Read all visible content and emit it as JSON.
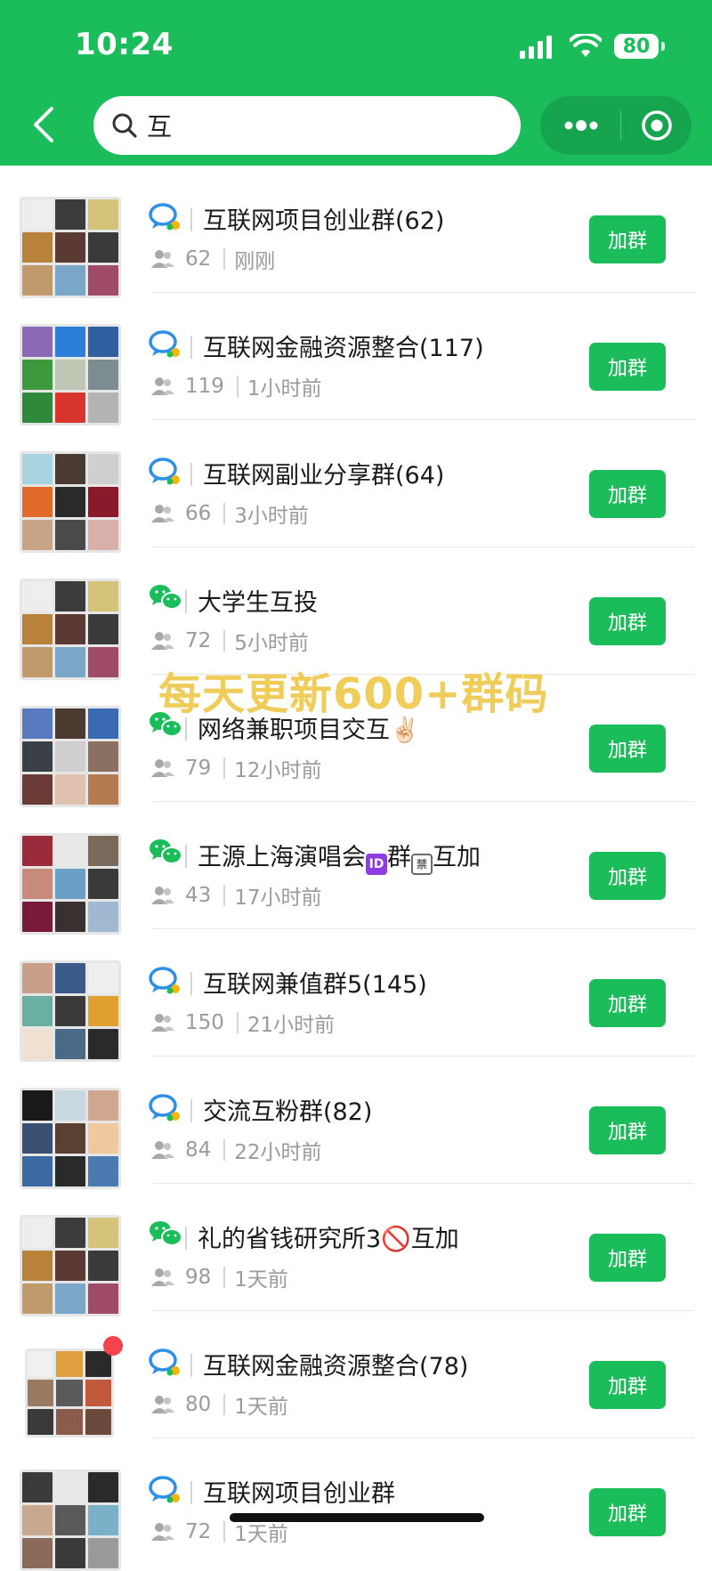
{
  "status_bar": {
    "time": "10:24",
    "battery": "80"
  },
  "search": {
    "value": "互"
  },
  "groups": [
    {
      "title": "互联网项目创业群(62)",
      "members": "62",
      "time": "刚刚",
      "type": "multi",
      "button": "加群"
    },
    {
      "title": "互联网金融资源整合(117)",
      "members": "119",
      "time": "1小时前",
      "type": "multi",
      "button": "加群"
    },
    {
      "title": "互联网副业分享群(64)",
      "members": "66",
      "time": "3小时前",
      "type": "multi",
      "button": "加群"
    },
    {
      "title": "大学生互投",
      "members": "72",
      "time": "5小时前",
      "type": "wechat",
      "button": "加群"
    },
    {
      "title": "网络兼职项目交互✌🏻",
      "members": "79",
      "time": "12小时前",
      "type": "wechat",
      "button": "加群"
    },
    {
      "title": "王源上海演唱会",
      "title_mid": "群",
      "title_end": "互加",
      "members": "43",
      "time": "17小时前",
      "type": "wechat",
      "button": "加群"
    },
    {
      "title": "互联网兼值群5(145)",
      "members": "150",
      "time": "21小时前",
      "type": "multi",
      "button": "加群"
    },
    {
      "title": "交流互粉群(82)",
      "members": "84",
      "time": "22小时前",
      "type": "multi",
      "button": "加群"
    },
    {
      "title": "礼的省钱研究所3🚫互加",
      "members": "98",
      "time": "1天前",
      "type": "wechat",
      "button": "加群"
    },
    {
      "title": "互联网金融资源整合(78)",
      "members": "80",
      "time": "1天前",
      "type": "multi",
      "button": "加群"
    },
    {
      "title": "互联网项目创业群",
      "members": "72",
      "time": "1天前",
      "type": "multi",
      "button": "加群"
    }
  ],
  "watermark": "每天更新600+群码",
  "colors": {
    "brand": "#1bbd5a",
    "badge": "#f5424b",
    "watermark": "#efc94c"
  }
}
